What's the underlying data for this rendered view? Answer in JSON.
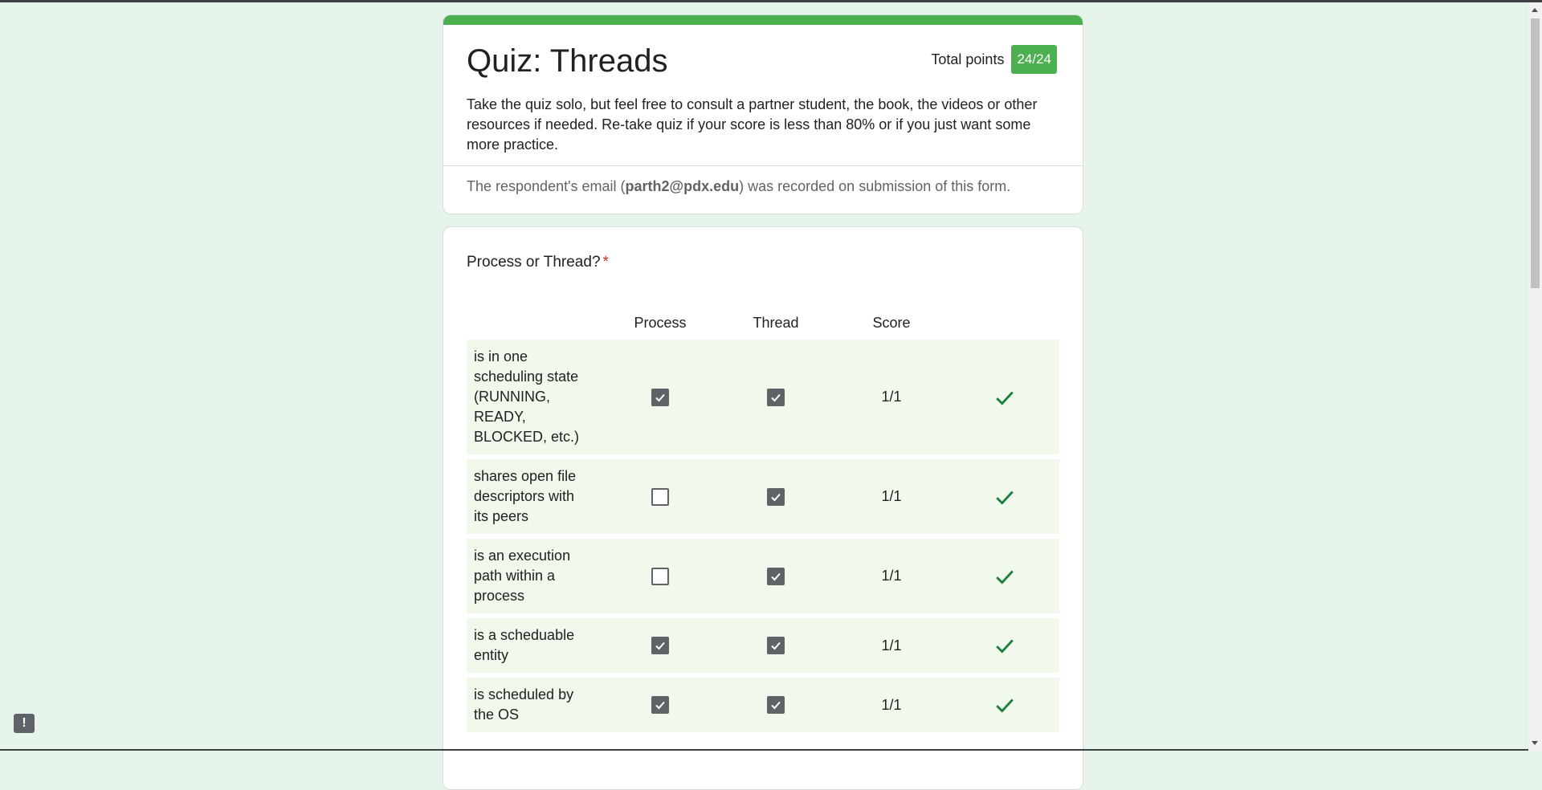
{
  "header": {
    "title": "Quiz: Threads",
    "total_points_label": "Total points",
    "total_points_value": "24/24",
    "description": "Take the quiz solo, but feel free to consult a partner student, the book, the videos or other resources if needed. Re-take quiz if your score is less than 80% or if you just want some more practice.",
    "email_prefix": "The respondent's email (",
    "email": "parth2@pdx.edu",
    "email_suffix": ") was recorded on submission of this form."
  },
  "question": {
    "title": "Process or Thread?",
    "required_mark": "*",
    "columns": [
      "Process",
      "Thread",
      "Score"
    ],
    "rows": [
      {
        "label": "is in one scheduling state (RUNNING, READY, BLOCKED, etc.)",
        "process": true,
        "thread": true,
        "score": "1/1",
        "correct": true
      },
      {
        "label": "shares open file descriptors with its peers",
        "process": false,
        "thread": true,
        "score": "1/1",
        "correct": true
      },
      {
        "label": "is an execution path within a process",
        "process": false,
        "thread": true,
        "score": "1/1",
        "correct": true
      },
      {
        "label": "is a scheduable entity",
        "process": true,
        "thread": true,
        "score": "1/1",
        "correct": true
      },
      {
        "label": "is scheduled by the OS",
        "process": true,
        "thread": true,
        "score": "1/1",
        "correct": true
      }
    ]
  },
  "icons": {
    "correct": "check-icon",
    "feedback": "report-feedback-icon"
  },
  "colors": {
    "accent": "#4caf50",
    "background": "#e6f4ea",
    "correct": "#188038",
    "required": "#d93025"
  }
}
